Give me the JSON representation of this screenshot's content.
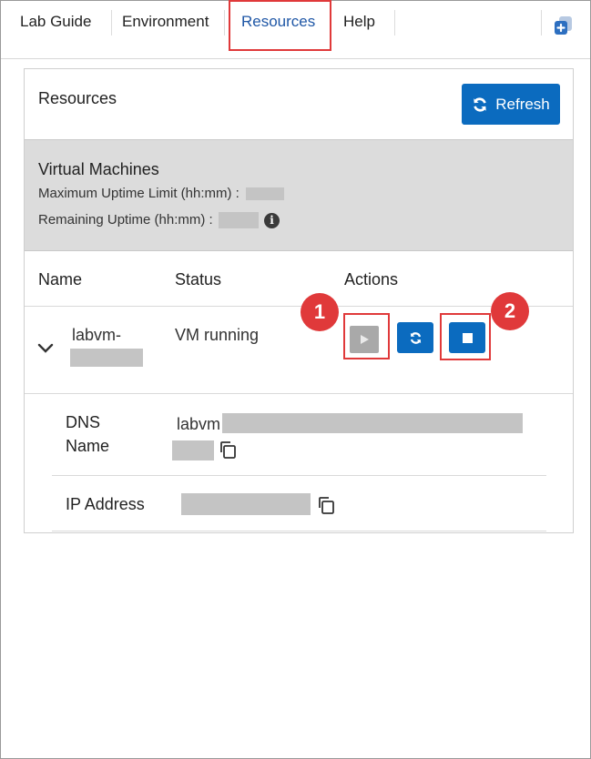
{
  "tabs": [
    {
      "label": "Lab Guide"
    },
    {
      "label": "Environment"
    },
    {
      "label": "Resources"
    },
    {
      "label": "Help"
    }
  ],
  "active_tab": "Resources",
  "resources": {
    "title": "Resources",
    "refresh_label": "Refresh"
  },
  "vm_panel": {
    "title": "Virtual Machines",
    "max_uptime_label": "Maximum Uptime Limit (hh:mm) :",
    "remaining_uptime_label": "Remaining Uptime (hh:mm) :",
    "info_glyph": "i"
  },
  "table": {
    "headers": [
      "Name",
      "Status",
      "Actions"
    ]
  },
  "vm_row": {
    "name_prefix": "labvm-",
    "status": "VM running"
  },
  "details": {
    "dns_label_line1": "DNS",
    "dns_label_line2": "Name",
    "dns_value_prefix": "labvm",
    "ip_label": "IP Address"
  },
  "annotations": [
    "1",
    "2"
  ],
  "colors": {
    "accent": "#0b6bbf",
    "highlight": "#e0393a",
    "active_tab_text": "#1f57a6",
    "panel_bg": "#dcdcdc",
    "disabled_button": "#a9a9a9"
  }
}
